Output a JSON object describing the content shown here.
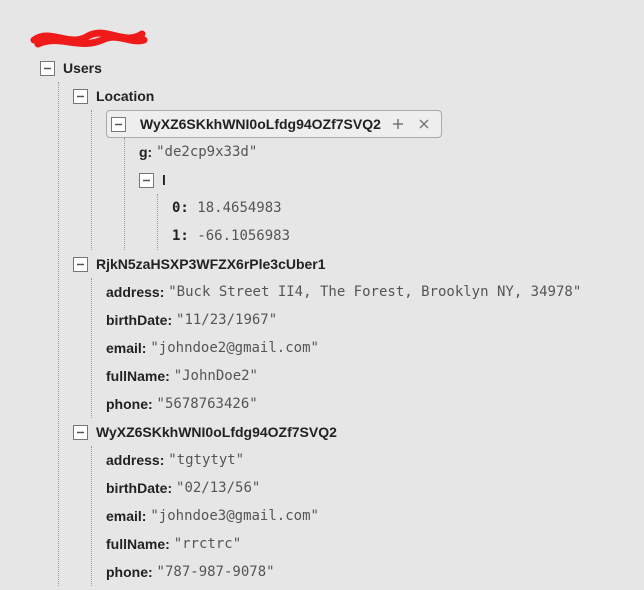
{
  "root": {
    "label": "Users"
  },
  "location": {
    "label": "Location",
    "selected_id": "WyXZ6SKkhWNI0oLfdg94OZf7SVQ2",
    "g": {
      "key": "g:",
      "value": "\"de2cp9x33d\""
    },
    "l": {
      "key": "l"
    },
    "coords": {
      "0": {
        "key": "0:",
        "value": "18.4654983"
      },
      "1": {
        "key": "1:",
        "value": "-66.1056983"
      }
    }
  },
  "users": [
    {
      "id": "RjkN5zaHSXP3WFZX6rPle3cUber1",
      "fields": {
        "address": {
          "key": "address:",
          "value": "\"Buck Street II4, The Forest, Brooklyn NY, 34978\""
        },
        "birthDate": {
          "key": "birthDate:",
          "value": "\"11/23/1967\""
        },
        "email": {
          "key": "email:",
          "value": "\"johndoe2@gmail.com\""
        },
        "fullName": {
          "key": "fullName:",
          "value": "\"JohnDoe2\""
        },
        "phone": {
          "key": "phone:",
          "value": "\"5678763426\""
        }
      }
    },
    {
      "id": "WyXZ6SKkhWNI0oLfdg94OZf7SVQ2",
      "fields": {
        "address": {
          "key": "address:",
          "value": "\"tgtytyt\""
        },
        "birthDate": {
          "key": "birthDate:",
          "value": "\"02/13/56\""
        },
        "email": {
          "key": "email:",
          "value": "\"johndoe3@gmail.com\""
        },
        "fullName": {
          "key": "fullName:",
          "value": "\"rrctrc\""
        },
        "phone": {
          "key": "phone:",
          "value": "\"787-987-9078\""
        }
      }
    }
  ]
}
